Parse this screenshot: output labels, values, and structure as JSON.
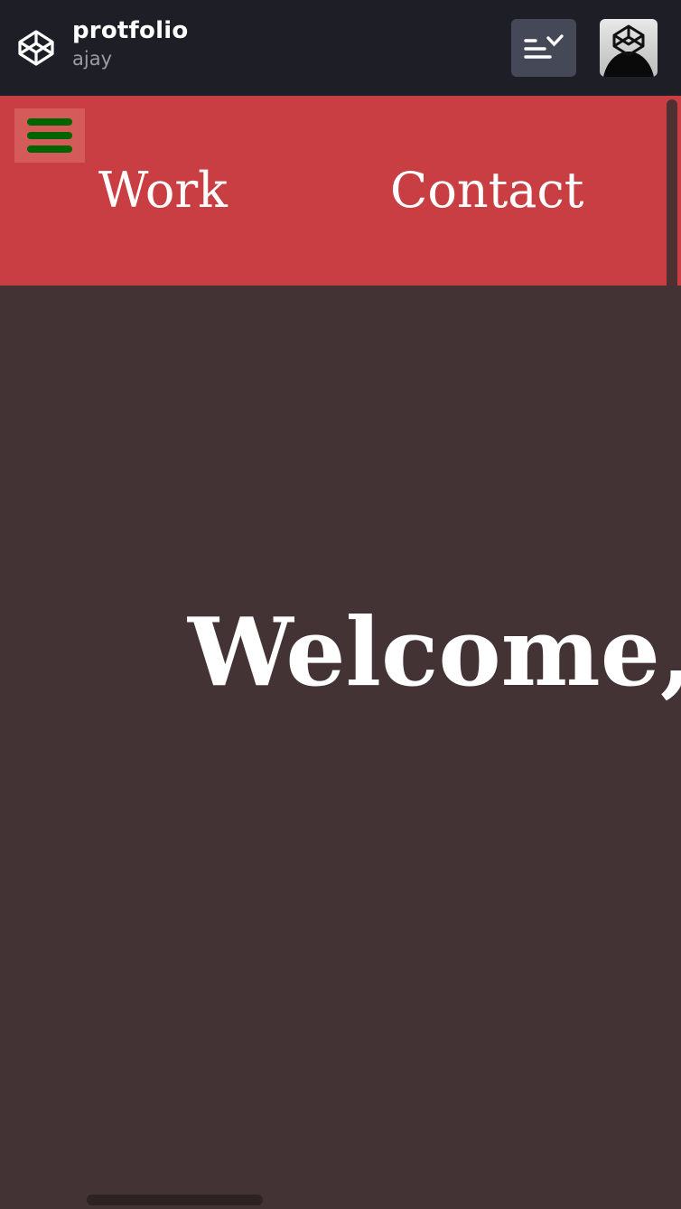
{
  "header": {
    "title": "protfolio",
    "author": "ajay",
    "logo_icon": "codepen-logo-icon",
    "view_toggle_icon": "layout-list-check-icon",
    "avatar_icon": "user-avatar-icon"
  },
  "nav": {
    "menu_icon": "hamburger-menu-icon",
    "links": [
      {
        "label": "Work"
      },
      {
        "label": "Contact"
      }
    ]
  },
  "hero": {
    "heading": "Welcome,"
  },
  "colors": {
    "topbar": "#1e1f26",
    "navbar": "#c83e42",
    "hamburger_bg": "#d55a5a",
    "hamburger_lines": "#006400",
    "hero_bg": "#433335",
    "text": "#ffffff"
  }
}
